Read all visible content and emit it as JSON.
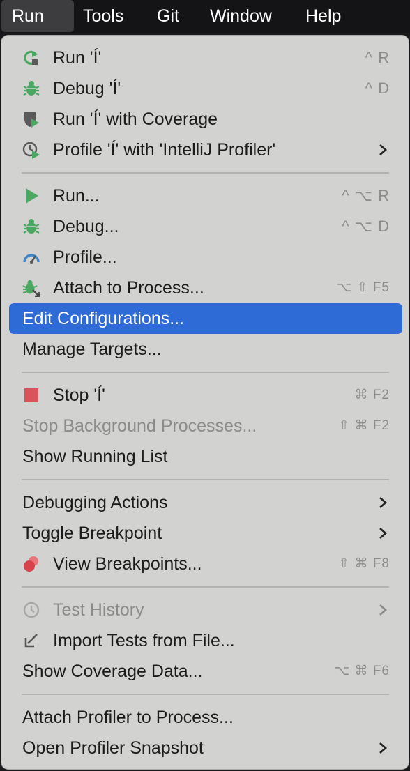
{
  "menubar": {
    "items": [
      "Run",
      "Tools",
      "Git",
      "Window",
      "Help"
    ],
    "active": "Run"
  },
  "menu": {
    "items": [
      {
        "label": "Run 'Í'",
        "shortcut": "^ R",
        "icon": "rerun-icon"
      },
      {
        "label": "Debug 'Í'",
        "shortcut": "^ D",
        "icon": "debug-bug-icon"
      },
      {
        "label": "Run 'Í' with Coverage",
        "shortcut": "",
        "icon": "coverage-shield-icon"
      },
      {
        "label": "Profile 'Í' with 'IntelliJ Profiler'",
        "shortcut": "",
        "icon": "profiler-clock-icon",
        "submenu": true
      },
      {
        "label": "Run...",
        "shortcut": "^ ⌥ R",
        "icon": "play-icon"
      },
      {
        "label": "Debug...",
        "shortcut": "^ ⌥ D",
        "icon": "debug-bug-icon"
      },
      {
        "label": "Profile...",
        "shortcut": "",
        "icon": "speedometer-icon"
      },
      {
        "label": "Attach to Process...",
        "shortcut": "⌥ ⇧ F5",
        "icon": "attach-bug-icon"
      },
      {
        "label": "Edit Configurations...",
        "shortcut": "",
        "selected": true
      },
      {
        "label": "Manage Targets...",
        "shortcut": ""
      },
      {
        "label": "Stop 'Í'",
        "shortcut": "⌘ F2",
        "icon": "stop-square-icon"
      },
      {
        "label": "Stop Background Processes...",
        "shortcut": "⇧ ⌘ F2",
        "disabled": true
      },
      {
        "label": "Show Running List",
        "shortcut": ""
      },
      {
        "label": "Debugging Actions",
        "shortcut": "",
        "submenu": true
      },
      {
        "label": "Toggle Breakpoint",
        "shortcut": "",
        "submenu": true
      },
      {
        "label": "View Breakpoints...",
        "shortcut": "⇧ ⌘ F8",
        "icon": "breakpoints-icon"
      },
      {
        "label": "Test History",
        "shortcut": "",
        "icon": "history-clock-icon",
        "disabled": true,
        "submenu": true
      },
      {
        "label": "Import Tests from File...",
        "shortcut": "",
        "icon": "import-arrow-icon"
      },
      {
        "label": "Show Coverage Data...",
        "shortcut": "⌥ ⌘ F6"
      },
      {
        "label": "Attach Profiler to Process...",
        "shortcut": ""
      },
      {
        "label": "Open Profiler Snapshot",
        "shortcut": "",
        "submenu": true
      }
    ]
  },
  "colors": {
    "menu_bg": "#d2d2d1",
    "selection": "#2f6bd7",
    "run_green": "#4aa862",
    "stop_red": "#d8545a",
    "menubar_bg": "#141416"
  }
}
